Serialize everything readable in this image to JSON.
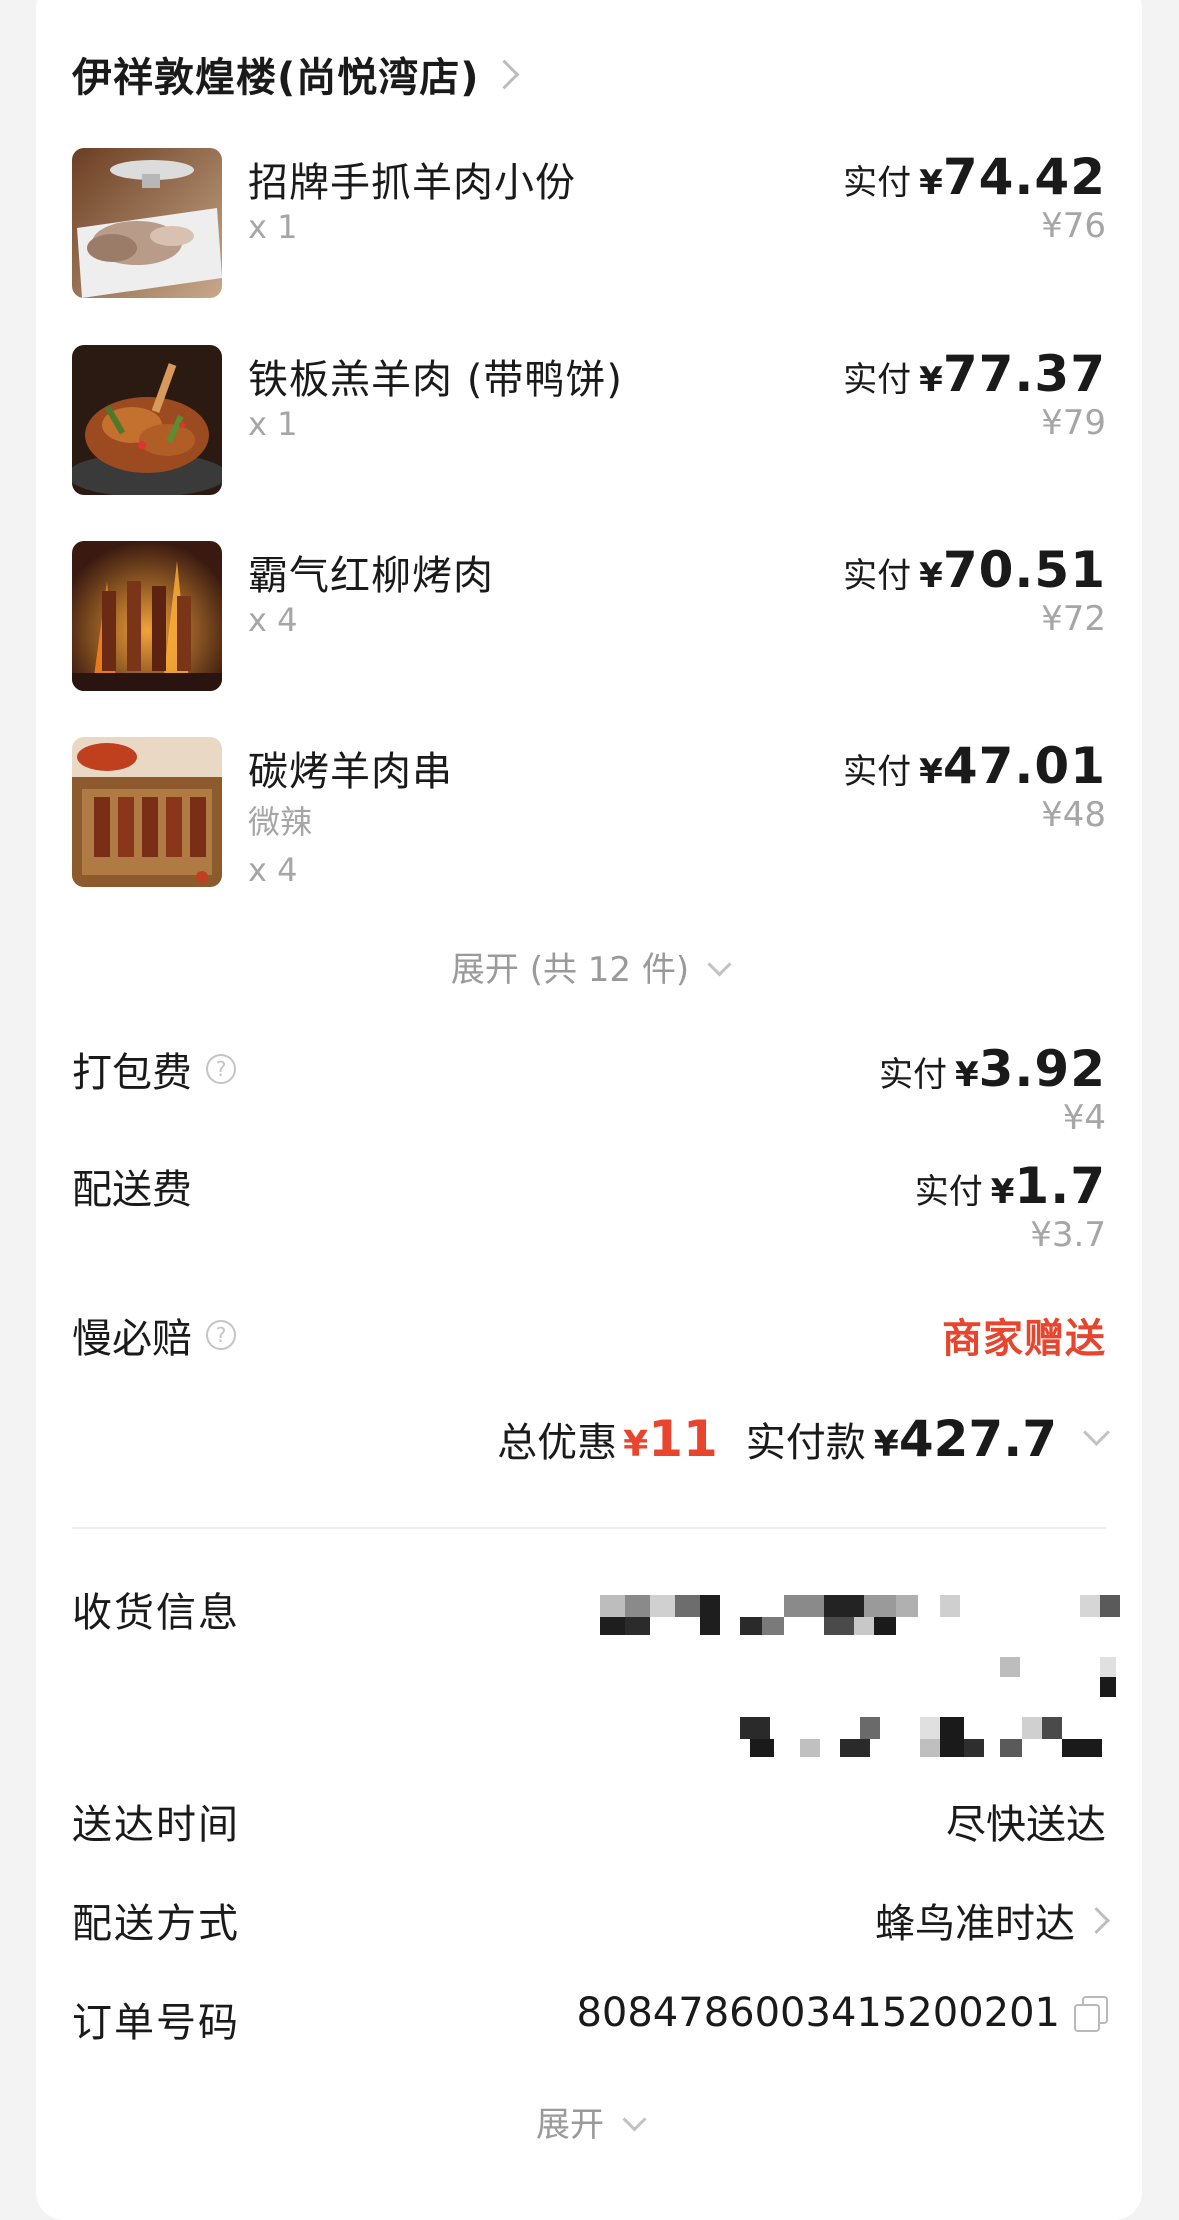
{
  "store": {
    "name": "伊祥敦煌楼(尚悦湾店)"
  },
  "items": [
    {
      "name": "招牌手抓羊肉小份",
      "spec": "",
      "qty": "x 1",
      "paid_label": "实付",
      "yen": "¥",
      "paid": "74.42",
      "orig": "¥76"
    },
    {
      "name": "铁板羔羊肉 (带鸭饼)",
      "spec": "",
      "qty": "x 1",
      "paid_label": "实付",
      "yen": "¥",
      "paid": "77.37",
      "orig": "¥79"
    },
    {
      "name": "霸气红柳烤肉",
      "spec": "",
      "qty": "x 4",
      "paid_label": "实付",
      "yen": "¥",
      "paid": "70.51",
      "orig": "¥72"
    },
    {
      "name": "碳烤羊肉串",
      "spec": "微辣",
      "qty": "x 4",
      "paid_label": "实付",
      "yen": "¥",
      "paid": "47.01",
      "orig": "¥48"
    }
  ],
  "expand_items": {
    "label": "展开 (共 12 件)"
  },
  "fees": {
    "packing": {
      "label": "打包费",
      "paid_label": "实付",
      "yen": "¥",
      "paid": "3.92",
      "orig": "¥4"
    },
    "delivery": {
      "label": "配送费",
      "paid_label": "实付",
      "yen": "¥",
      "paid": "1.7",
      "orig": "¥3.7"
    },
    "late_compensation": {
      "label": "慢必赔",
      "value": "商家赠送"
    }
  },
  "summary": {
    "discount_label": "总优惠",
    "discount_yen": "¥",
    "discount": "11",
    "total_label": "实付款",
    "total_yen": "¥",
    "total": "427.7"
  },
  "info": {
    "receiver_label": "收货信息",
    "delivery_time_label": "送达时间",
    "delivery_time": "尽快送达",
    "delivery_method_label": "配送方式",
    "delivery_method": "蜂鸟准时达",
    "order_no_label": "订单号码",
    "order_no": "8084786003415200201"
  },
  "expand_more": {
    "label": "展开"
  },
  "colors": {
    "accent_red": "#e8452e",
    "text": "#1a1a1a",
    "muted": "#a6a6a6"
  },
  "icons": [
    "chevron-right-icon",
    "help-icon",
    "chevron-down-icon",
    "copy-icon"
  ]
}
